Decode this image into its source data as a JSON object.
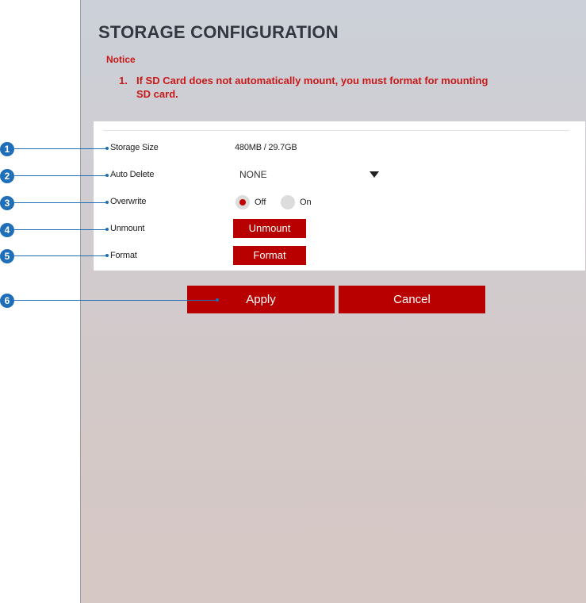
{
  "page": {
    "title": "STORAGE CONFIGURATION",
    "notice_label": "Notice",
    "notice_number": "1.",
    "notice_line1": "If SD Card does not automatically mount, you must format for mounting",
    "notice_line2": "SD card."
  },
  "settings": {
    "storage_size": {
      "label": "Storage Size",
      "value": "480MB / 29.7GB"
    },
    "auto_delete": {
      "label": "Auto Delete",
      "value": "NONE"
    },
    "overwrite": {
      "label": "Overwrite",
      "options": [
        "Off",
        "On"
      ],
      "selected": "Off"
    },
    "unmount": {
      "label": "Unmount",
      "button": "Unmount"
    },
    "format": {
      "label": "Format",
      "button": "Format"
    }
  },
  "actions": {
    "apply": "Apply",
    "cancel": "Cancel"
  },
  "callouts": [
    "1",
    "2",
    "3",
    "4",
    "5",
    "6"
  ],
  "colors": {
    "accent": "#b80000",
    "notice": "#c81818",
    "callout": "#1f6fb8"
  }
}
